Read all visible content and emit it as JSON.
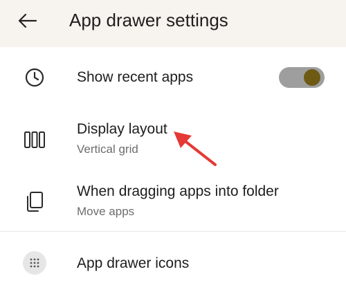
{
  "header": {
    "title": "App drawer settings",
    "back_icon": "arrow-left-icon"
  },
  "settings": [
    {
      "label": "Show recent apps",
      "icon": "clock-icon",
      "toggle_on": true
    },
    {
      "label": "Display layout",
      "sub": "Vertical grid",
      "icon": "columns-icon"
    },
    {
      "label": "When dragging apps into folder",
      "sub": "Move apps",
      "icon": "copy-icon"
    },
    {
      "label": "App drawer icons",
      "icon": "grid-dots-icon"
    }
  ],
  "colors": {
    "header_bg": "#f7f3ee",
    "toggle_track": "#9e9e9e",
    "toggle_knob": "#6e5a12",
    "annotation_arrow": "#e53935"
  },
  "annotation": {
    "type": "arrow",
    "points_to": "Display layout"
  }
}
